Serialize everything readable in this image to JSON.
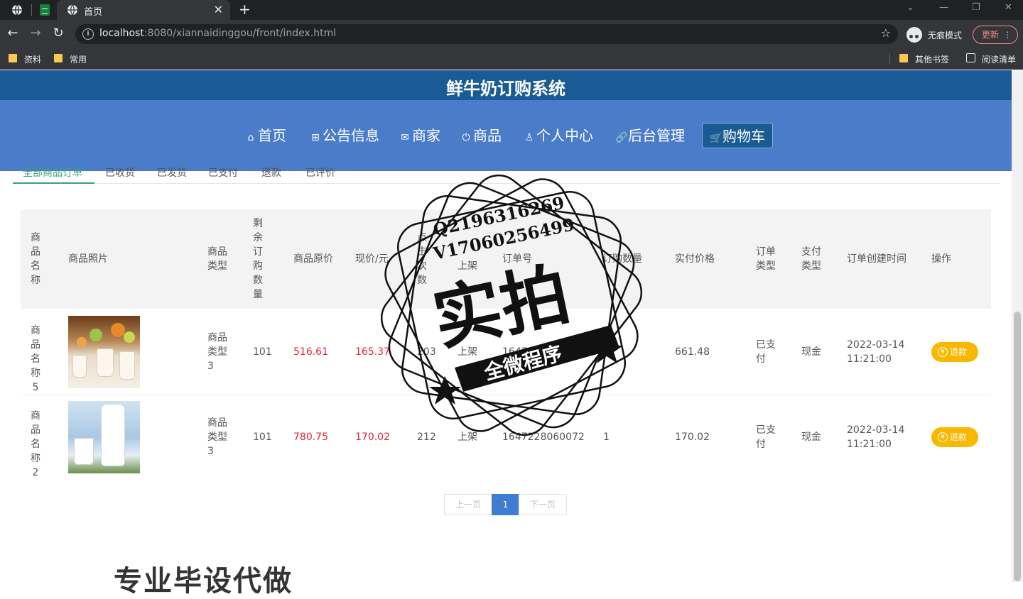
{
  "browser": {
    "tab_title": "首页",
    "url_host": "localhost",
    "url_rest": ":8080/xiannaidinggou/front/index.html",
    "incognito_label": "无痕模式",
    "update_label": "更新",
    "bookmarks": [
      "资料",
      "常用"
    ],
    "bookmarks_right": [
      "其他书签",
      "阅读清单"
    ]
  },
  "site": {
    "title": "鲜牛奶订购系统",
    "nav": [
      {
        "label": "首页",
        "icon": "home-icon"
      },
      {
        "label": "公告信息",
        "icon": "gift-icon"
      },
      {
        "label": "商家",
        "icon": "mail-icon"
      },
      {
        "label": "商品",
        "icon": "power-icon"
      },
      {
        "label": "个人中心",
        "icon": "user-icon"
      },
      {
        "label": "后台管理",
        "icon": "link-icon"
      },
      {
        "label": "购物车",
        "icon": "cart-icon"
      }
    ],
    "active_nav": "购物车"
  },
  "order_tabs": [
    "全部商品订单",
    "已收货",
    "已发货",
    "已支付",
    "退款",
    "已评价"
  ],
  "table": {
    "headers": [
      "商品名称",
      "商品照片",
      "商品类型",
      "剩余订购数量",
      "商品原价",
      "现价/元",
      "点击次数",
      "上架",
      "订单号",
      "订购数量",
      "实付价格",
      "订单类型",
      "支付类型",
      "订单创建时间",
      "操作"
    ],
    "rows": [
      {
        "name": "商品名称5",
        "photo": "milk-glasses-photo",
        "type": "商品类型3",
        "remaining": "101",
        "orig_price": "516.61",
        "price": "165.37",
        "clicks": "203",
        "status": "上架",
        "order_no": "16472",
        "qty": "",
        "paid": "661.48",
        "order_type": "已支付",
        "pay_type": "现金",
        "date": "2022-03-14",
        "time": "11:21:00",
        "action": "退款"
      },
      {
        "name": "商品名称2",
        "photo": "milk-bottle-photo",
        "type": "商品类型3",
        "remaining": "101",
        "orig_price": "780.75",
        "price": "170.02",
        "clicks": "212",
        "status": "上架",
        "order_no": "1647228060072",
        "qty": "1",
        "paid": "170.02",
        "order_type": "已支付",
        "pay_type": "现金",
        "date": "2022-03-14",
        "time": "11:21:00",
        "action": "退款"
      }
    ]
  },
  "pagination": {
    "prev": "上一页",
    "current": "1",
    "next": "下一页"
  },
  "watermark": {
    "line1": "Q2196316269",
    "line2": "V17060256499",
    "main": "实拍",
    "banner": "全微程序"
  },
  "bottom_text": "专业毕设代做",
  "colors": {
    "title_bar": "#1a5b96",
    "nav_bar": "#4a7cca",
    "price_red": "#e0243b",
    "refund_yellow": "#f9b800",
    "tab_green": "#409e7a",
    "pager_blue": "#3e7dd1"
  }
}
